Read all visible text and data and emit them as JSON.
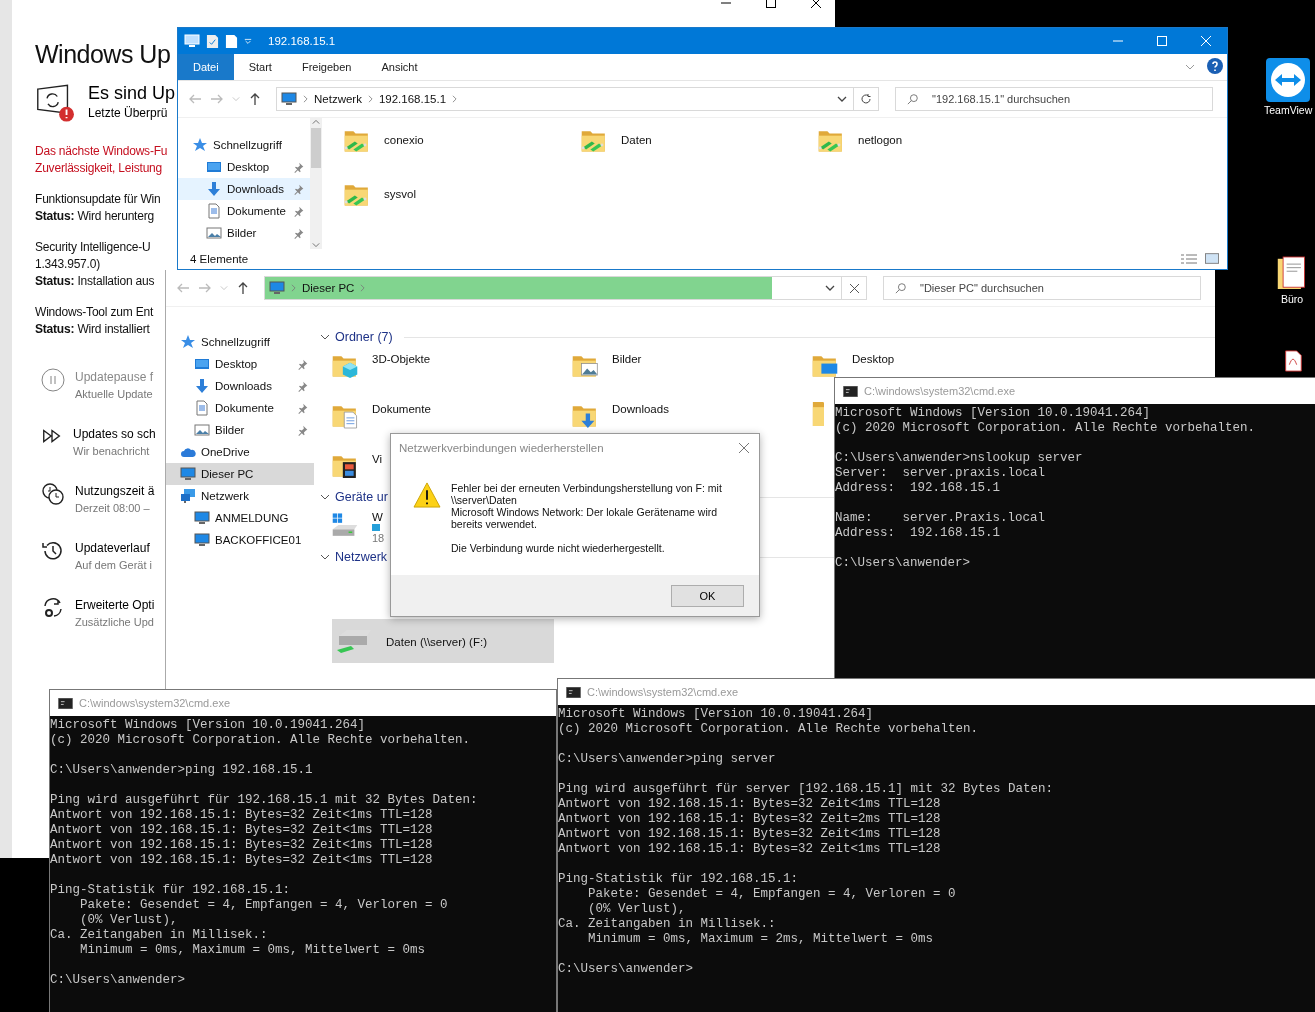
{
  "desktop_icons": [
    {
      "kind": "teamviewer",
      "label": "TeamView"
    },
    {
      "kind": "document",
      "label": "Büro"
    },
    {
      "kind": "pdf"
    }
  ],
  "settings_window": {
    "title": "Windows Up",
    "status_title": "Es sind Up",
    "status_subtitle": "Letzte Überprü",
    "warning": [
      "Das nächste Windows-Fu",
      "Zuverlässigkeit, Leistung"
    ],
    "updates": [
      {
        "lines": [
          "Funktionsupdate für Win"
        ],
        "status": "**Status:** Wird herunterg"
      },
      {
        "lines": [
          "Security Intelligence-U",
          "1.343.957.0)"
        ],
        "status": "**Status:** Installation aus"
      },
      {
        "lines": [
          "Windows-Tool zum Ent"
        ],
        "status": "**Status:** Wird installiert"
      }
    ],
    "options": [
      {
        "kind": "pause",
        "title": "Updatepause f",
        "subtitle": "Aktuelle Update",
        "disabled": true
      },
      {
        "kind": "forward",
        "title": "Updates so sch",
        "subtitle": "Wir benachricht",
        "disabled": false
      },
      {
        "kind": "clock",
        "title": "Nutzungszeit ä",
        "subtitle": "Derzeit 08:00 –",
        "disabled": false
      },
      {
        "kind": "history",
        "title": "Updateverlauf",
        "subtitle": "Auf dem Gerät i",
        "disabled": false
      },
      {
        "kind": "gear",
        "title": "Erweiterte Opti",
        "subtitle": "Zusätzliche Upd",
        "disabled": false
      }
    ]
  },
  "explorer_back": {
    "address": {
      "path": [
        "Dieser PC"
      ],
      "level": 0.88
    },
    "search": {
      "placeholder": "\"Dieser PC\" durchsuchen"
    },
    "nav": [
      {
        "label": "Schnellzugriff",
        "kind": "star",
        "selected": false,
        "children": [
          {
            "label": "Desktop",
            "kind": "desktop",
            "selected": false,
            "pinned": true
          },
          {
            "label": "Downloads",
            "kind": "download",
            "selected": false,
            "pinned": true
          },
          {
            "label": "Dokumente",
            "kind": "document",
            "selected": false,
            "pinned": true
          },
          {
            "label": "Bilder",
            "kind": "pictures",
            "selected": false,
            "pinned": true
          }
        ]
      },
      {
        "label": "OneDrive",
        "kind": "cloud",
        "selected": false
      },
      {
        "label": "Dieser PC",
        "kind": "pc",
        "selected": true
      },
      {
        "label": "Netzwerk",
        "kind": "network",
        "selected": false,
        "children": [
          {
            "label": "ANMELDUNG",
            "kind": "pc",
            "selected": false
          },
          {
            "label": "BACKOFFICE01",
            "kind": "pc",
            "selected": false
          }
        ]
      }
    ],
    "groups": [
      {
        "title": "Ordner (7)",
        "expanded": true,
        "items": [
          {
            "label": "3D-Objekte",
            "kind": "folder-3d",
            "selected": false
          },
          {
            "label": "Bilder",
            "kind": "folder-pictures",
            "selected": false
          },
          {
            "label": "Desktop",
            "kind": "folder-desktop",
            "selected": false
          },
          {
            "label": "Dokumente",
            "kind": "folder-documents",
            "selected": false
          },
          {
            "label": "Downloads",
            "kind": "folder-downloads",
            "selected": false
          },
          {
            "kind": "folder-music",
            "selected": false
          },
          {
            "label": "Vi",
            "kind": "folder-videos",
            "selected": false
          }
        ]
      },
      {
        "title": "Geräte ur",
        "expanded": true,
        "items": [
          {
            "label": "W",
            "detail": "18",
            "kind": "drive-windows",
            "selected": false
          }
        ]
      },
      {
        "title": "Netzwerk",
        "expanded": true,
        "items": [
          {
            "label": "Daten (\\\\server) (F:)",
            "kind": "drive-network",
            "selected": true
          }
        ]
      }
    ]
  },
  "explorer_front": {
    "title": "192.168.15.1",
    "ribbon_tabs": [
      {
        "label": "Datei",
        "selected": true
      },
      {
        "label": "Start",
        "selected": false
      },
      {
        "label": "Freigeben",
        "selected": false
      },
      {
        "label": "Ansicht",
        "selected": false
      }
    ],
    "address": {
      "path": [
        "Netzwerk",
        "192.168.15.1"
      ]
    },
    "search": {
      "placeholder": "\"192.168.15.1\" durchsuchen"
    },
    "nav": [
      {
        "label": "Schnellzugriff",
        "kind": "star",
        "selected": false,
        "children": [
          {
            "label": "Desktop",
            "kind": "desktop",
            "selected": false,
            "pinned": true
          },
          {
            "label": "Downloads",
            "kind": "download",
            "selected": true,
            "pinned": true
          },
          {
            "label": "Dokumente",
            "kind": "document",
            "selected": false,
            "pinned": true
          },
          {
            "label": "Bilder",
            "kind": "pictures",
            "selected": false,
            "pinned": true
          }
        ]
      }
    ],
    "items": [
      {
        "label": "conexio",
        "kind": "share",
        "selected": false
      },
      {
        "label": "Daten",
        "kind": "share",
        "selected": false
      },
      {
        "label": "netlogon",
        "kind": "share",
        "selected": false
      },
      {
        "label": "sysvol",
        "kind": "share",
        "selected": false
      }
    ],
    "status_bar": "4 Elemente"
  },
  "dialog": {
    "title": "Netzwerkverbindungen wiederherstellen",
    "paragraphs": [
      "Fehler bei der erneuten Verbindungsherstellung von F: mit \\\\server\\Daten",
      "Microsoft Windows Network: Der lokale Gerätename wird bereits verwendet.",
      "Die Verbindung wurde nicht wiederhergestellt."
    ],
    "button": "OK"
  },
  "consoles": [
    {
      "title": "C:\\windows\\system32\\cmd.exe",
      "blocks": [
        [
          "Microsoft Windows [Version 10.0.19041.264]",
          "(c) 2020 Microsoft Corporation. Alle Rechte vorbehalten."
        ],
        [
          "C:\\Users\\anwender>nslookup server",
          "Server:  server.praxis.local",
          "Address:  192.168.15.1"
        ],
        [
          "Name:    server.Praxis.local",
          "Address:  192.168.15.1"
        ],
        [
          "C:\\Users\\anwender>"
        ]
      ]
    },
    {
      "title": "C:\\windows\\system32\\cmd.exe",
      "blocks": [
        [
          "Microsoft Windows [Version 10.0.19041.264]",
          "(c) 2020 Microsoft Corporation. Alle Rechte vorbehalten."
        ],
        [
          "C:\\Users\\anwender>ping 192.168.15.1"
        ],
        [
          "Ping wird ausgeführt für 192.168.15.1 mit 32 Bytes Daten:",
          "Antwort von 192.168.15.1: Bytes=32 Zeit<1ms TTL=128",
          "Antwort von 192.168.15.1: Bytes=32 Zeit<1ms TTL=128",
          "Antwort von 192.168.15.1: Bytes=32 Zeit<1ms TTL=128",
          "Antwort von 192.168.15.1: Bytes=32 Zeit<1ms TTL=128"
        ],
        [
          "Ping-Statistik für 192.168.15.1:",
          "    Pakete: Gesendet = 4, Empfangen = 4, Verloren = 0",
          "    (0% Verlust),",
          "Ca. Zeitangaben in Millisek.:",
          "    Minimum = 0ms, Maximum = 0ms, Mittelwert = 0ms"
        ],
        [
          "C:\\Users\\anwender>"
        ]
      ]
    },
    {
      "title": "C:\\windows\\system32\\cmd.exe",
      "blocks": [
        [
          "Microsoft Windows [Version 10.0.19041.264]",
          "(c) 2020 Microsoft Corporation. Alle Rechte vorbehalten."
        ],
        [
          "C:\\Users\\anwender>ping server"
        ],
        [
          "Ping wird ausgeführt für server [192.168.15.1] mit 32 Bytes Daten:",
          "Antwort von 192.168.15.1: Bytes=32 Zeit<1ms TTL=128",
          "Antwort von 192.168.15.1: Bytes=32 Zeit=2ms TTL=128",
          "Antwort von 192.168.15.1: Bytes=32 Zeit<1ms TTL=128",
          "Antwort von 192.168.15.1: Bytes=32 Zeit<1ms TTL=128"
        ],
        [
          "Ping-Statistik für 192.168.15.1:",
          "    Pakete: Gesendet = 4, Empfangen = 4, Verloren = 0",
          "    (0% Verlust),",
          "Ca. Zeitangaben in Millisek.:",
          "    Minimum = 0ms, Maximum = 2ms, Mittelwert = 0ms"
        ],
        [
          "C:\\Users\\anwender>"
        ]
      ]
    }
  ]
}
